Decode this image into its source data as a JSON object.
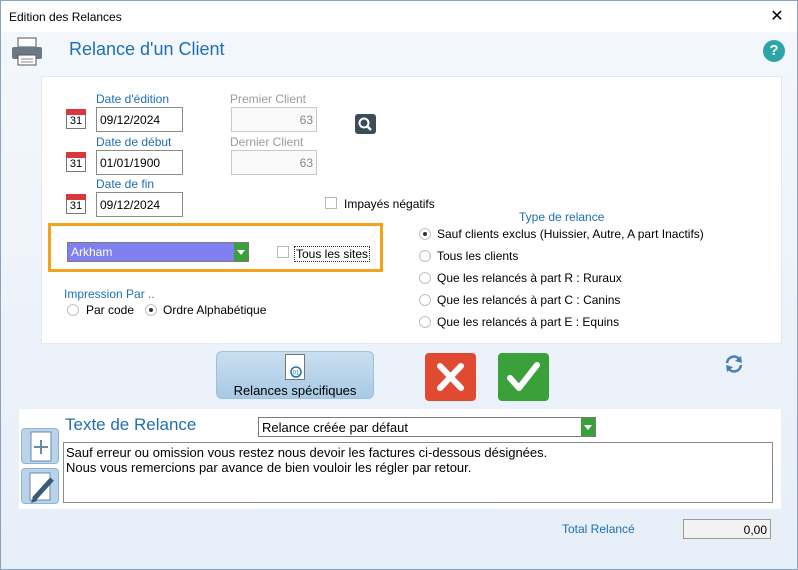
{
  "window": {
    "title": "Edition des Relances",
    "close": "✕"
  },
  "header": {
    "title": "Relance d'un Client",
    "help": "?"
  },
  "dates": {
    "edition": {
      "label": "Date d'édition",
      "value": "09/12/2024"
    },
    "debut": {
      "label": "Date de début",
      "value": "01/01/1900"
    },
    "fin": {
      "label": "Date de fin",
      "value": "09/12/2024"
    },
    "cal_day": "31"
  },
  "clients": {
    "premier": {
      "label": "Premier Client",
      "value": "63"
    },
    "dernier": {
      "label": "Dernier Client",
      "value": "63"
    }
  },
  "impayes": {
    "label": "Impayés négatifs"
  },
  "site": {
    "selected": "Arkham",
    "tous_label": "Tous les sites"
  },
  "impression": {
    "label": "Impression Par ..",
    "options": [
      "Par code",
      "Ordre Alphabétique"
    ],
    "selected": "Ordre Alphabétique"
  },
  "type_relance": {
    "label": "Type de relance",
    "options": [
      "Sauf clients exclus (Huissier, Autre, A part Inactifs)",
      "Tous les clients",
      "Que les relancés à part R : Ruraux",
      "Que les relancés à part C : Canins",
      "Que les relancés à part E : Equins"
    ],
    "selected": "Sauf clients exclus (Huissier, Autre, A part Inactifs)"
  },
  "buttons": {
    "specifiques": "Relances spécifiques",
    "doc_badge": "01"
  },
  "texte": {
    "title": "Texte de Relance",
    "model": "Relance créée par défaut",
    "line1": "Sauf erreur ou omission vous restez nous devoir les factures ci-dessous désignées.",
    "line2": "Nous vous remercions par avance de bien vouloir les régler par retour."
  },
  "total": {
    "label": "Total  Relancé",
    "value": "0,00"
  }
}
